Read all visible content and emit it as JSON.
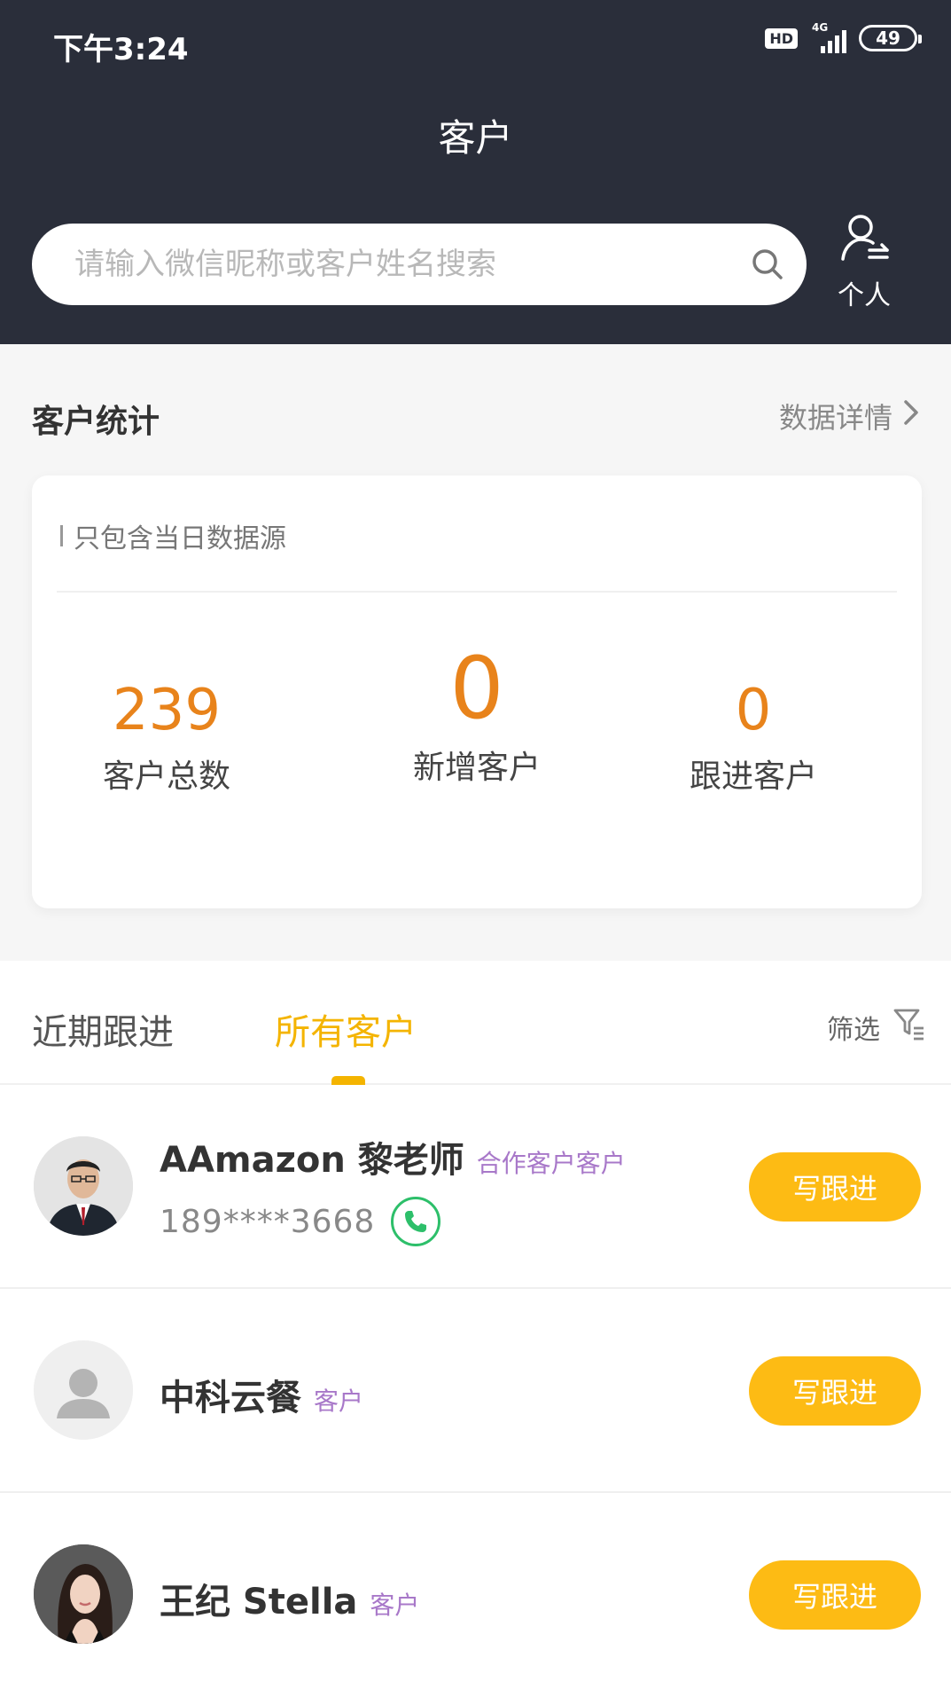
{
  "status_bar": {
    "time": "下午3:24",
    "hd": "HD",
    "network": "4G",
    "battery": "49"
  },
  "header": {
    "title": "客户",
    "search_placeholder": "请输入微信昵称或客户姓名搜索",
    "person_label": "个人"
  },
  "stats": {
    "title": "客户统计",
    "detail_link": "数据详情",
    "note": "只包含当日数据源",
    "items": [
      {
        "value": "239",
        "label": "客户总数"
      },
      {
        "value": "0",
        "label": "新增客户"
      },
      {
        "value": "0",
        "label": "跟进客户"
      }
    ]
  },
  "tabs": {
    "items": [
      {
        "label": "近期跟进",
        "active": false
      },
      {
        "label": "所有客户",
        "active": true
      }
    ],
    "filter_label": "筛选"
  },
  "customers": [
    {
      "name": "AAmazon 黎老师",
      "tag": "合作客户客户",
      "phone": "189****3668",
      "button": "写跟进",
      "avatar": "photo-man-suit-icon"
    },
    {
      "name": "中科云餐",
      "tag": "客户",
      "phone": "",
      "button": "写跟进",
      "avatar": "default-person-icon"
    },
    {
      "name": "王纪 Stella",
      "tag": "客户",
      "phone": "",
      "button": "写跟进",
      "avatar": "photo-woman-icon"
    }
  ],
  "colors": {
    "header_bg": "#2a2e3a",
    "accent_yellow": "#fdbb14",
    "stat_orange": "#e8831b",
    "tag_purple": "#a878c9",
    "phone_green": "#2dbf6a"
  }
}
